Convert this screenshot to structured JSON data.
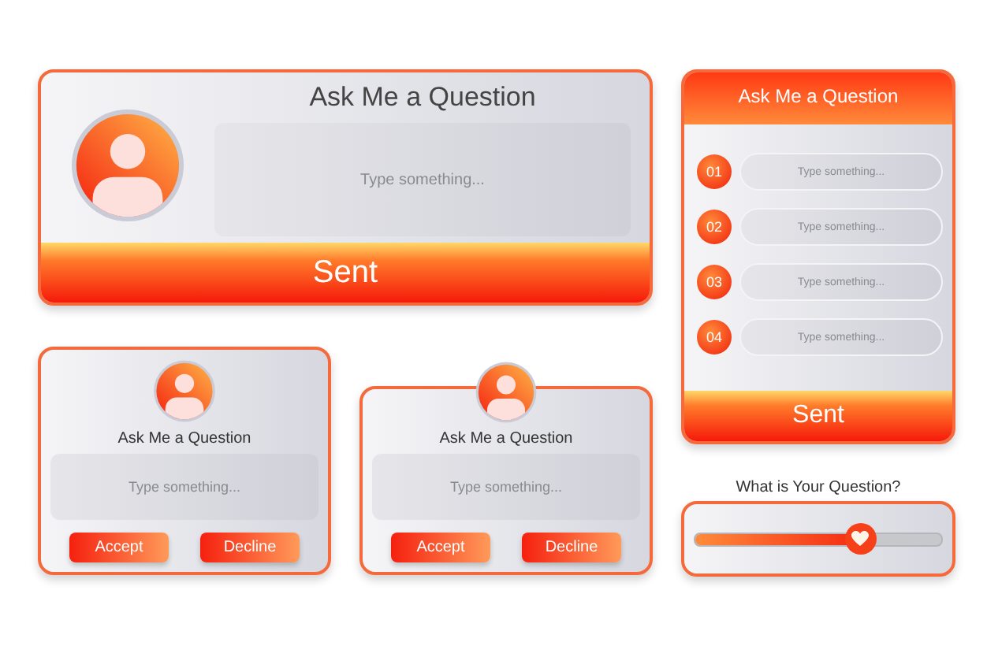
{
  "main_card": {
    "title": "Ask Me a Question",
    "placeholder": "Type something...",
    "button": "Sent"
  },
  "question_list_card": {
    "title": "Ask Me a Question",
    "items": [
      {
        "number": "01",
        "placeholder": "Type something..."
      },
      {
        "number": "02",
        "placeholder": "Type something..."
      },
      {
        "number": "03",
        "placeholder": "Type something..."
      },
      {
        "number": "04",
        "placeholder": "Type something..."
      }
    ],
    "button": "Sent"
  },
  "small_cards": [
    {
      "kind": "framed",
      "title": "Ask Me a Question",
      "placeholder": "Type something...",
      "buttons": [
        "Accept",
        "Decline"
      ]
    },
    {
      "kind": "popout",
      "title": "Ask Me a Question",
      "placeholder": "Type something...",
      "buttons": [
        "Accept",
        "Decline"
      ]
    }
  ],
  "slider_card": {
    "title": "What is Your Question?",
    "level": 0.67
  }
}
